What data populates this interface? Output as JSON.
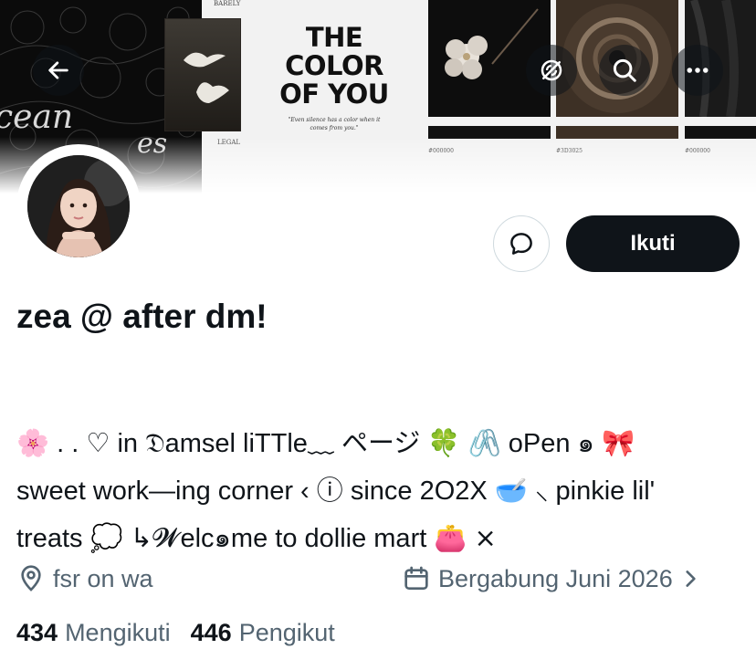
{
  "banner": {
    "lace_text_1": "cean",
    "lace_text_2": "es",
    "caption_top": "BARELY",
    "caption_bottom": "LEGAL",
    "title_line_1": "THE",
    "title_line_2": "COLOR",
    "title_line_3": "OF YOU",
    "quote_line_1": "\"Even silence has a color when it",
    "quote_line_2": "comes from you.\"",
    "swatches": [
      {
        "code": "#000000",
        "color": "#111111"
      },
      {
        "code": "#3D3025",
        "color": "#3D3025"
      },
      {
        "code": "#000000",
        "color": "#111111"
      }
    ]
  },
  "header_buttons": {
    "back_icon": "arrow-left-icon",
    "notify_icon": "bell-off-icon",
    "search_icon": "search-icon",
    "more_icon": "more-horizontal-icon"
  },
  "profile": {
    "display_name": "zea @ after dm!",
    "follow_label": "Ikuti",
    "message_icon": "message-bubble-icon"
  },
  "bio": {
    "line_1": "🌸 . . ♡ in 𝔇amsel liTTle﹏ ページ 🍀 🖇️ oPen ๑ 🎀",
    "line_2": "sweet work—ing corner ‹ ⓘ since 2O2X 🥣 ⸜ pinkie lil'",
    "line_3": "treats 💭 ↳𝓦elc๑me to dollie mart 👛 ⨯"
  },
  "meta": {
    "location": "fsr on wa",
    "joined": "Bergabung Juni 2026"
  },
  "stats": {
    "following_count": "434",
    "following_label": "Mengikuti",
    "followers_count": "446",
    "followers_label": "Pengikut"
  },
  "colors": {
    "text_primary": "#0f1419",
    "text_secondary": "#536471",
    "button_dark": "#0f1419",
    "border": "#cfd9de"
  }
}
